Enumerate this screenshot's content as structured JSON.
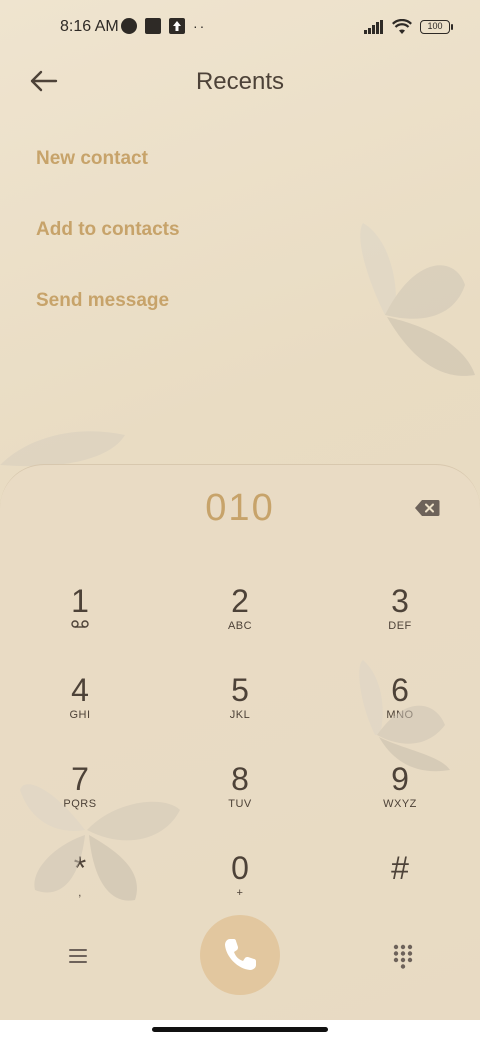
{
  "status_bar": {
    "time": "8:16 AM",
    "battery": "100"
  },
  "header": {
    "title": "Recents"
  },
  "actions": {
    "new_contact": "New contact",
    "add_to_contacts": "Add to contacts",
    "send_message": "Send message"
  },
  "dialer": {
    "number": "010",
    "keys": [
      {
        "digit": "1",
        "letters": ""
      },
      {
        "digit": "2",
        "letters": "ABC"
      },
      {
        "digit": "3",
        "letters": "DEF"
      },
      {
        "digit": "4",
        "letters": "GHI"
      },
      {
        "digit": "5",
        "letters": "JKL"
      },
      {
        "digit": "6",
        "letters": "MNO"
      },
      {
        "digit": "7",
        "letters": "PQRS"
      },
      {
        "digit": "8",
        "letters": "TUV"
      },
      {
        "digit": "9",
        "letters": "WXYZ"
      },
      {
        "digit": "*",
        "letters": ","
      },
      {
        "digit": "0",
        "letters": "+"
      },
      {
        "digit": "#",
        "letters": ""
      }
    ]
  },
  "colors": {
    "accent": "#c7a36a",
    "call_button": "#e2c79f",
    "text": "#4d4238"
  }
}
